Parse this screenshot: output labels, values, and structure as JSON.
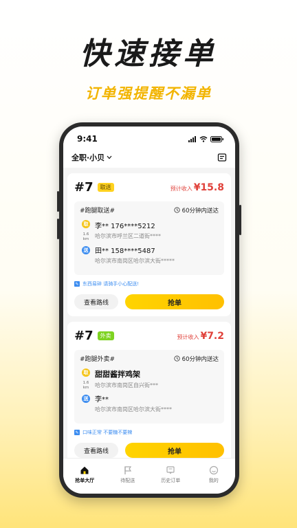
{
  "promo": {
    "headline": "快速接单",
    "subline": "订单强提醒不漏单"
  },
  "status_bar": {
    "time": "9:41"
  },
  "app_bar": {
    "user_label": "全职·小贝"
  },
  "orders": [
    {
      "number": "#7",
      "type_tag": "取送",
      "income_label": "预计收入",
      "income_value": "¥15.8",
      "category": "#跑腿取送#",
      "eta": "60分钟内送达",
      "pickup_badge": "取",
      "pickup_title": "李** 176****5212",
      "pickup_address": "哈尔滨市呼兰区二道街****",
      "distance_value": "1.6",
      "distance_unit": "km",
      "dropoff_badge": "送",
      "dropoff_title": "田** 158****5487",
      "dropoff_address": "哈尔滨市南岗区哈尔滨大街*****",
      "note": "东西易碎 请骑手小心配送!",
      "route_button": "查看路线",
      "grab_button": "抢单"
    },
    {
      "number": "#7",
      "type_tag": "外卖",
      "income_label": "预计收入",
      "income_value": "¥7.2",
      "category": "#跑腿外卖#",
      "eta": "60分钟内送达",
      "pickup_badge": "取",
      "pickup_title": "甜甜酱拌鸡架",
      "pickup_address": "哈尔滨市南岗区自兴街***",
      "distance_value": "1.6",
      "distance_unit": "km",
      "dropoff_badge": "送",
      "dropoff_title": "李**",
      "dropoff_address": "哈尔滨市南岗区哈尔滨大街****",
      "note": "口味正常 不要糖不要辣",
      "route_button": "查看路线",
      "grab_button": "抢单"
    }
  ],
  "tabs": [
    {
      "label": "抢单大厅",
      "icon": "home-icon",
      "active": true
    },
    {
      "label": "待配送",
      "icon": "flag-icon",
      "active": false
    },
    {
      "label": "历史订单",
      "icon": "history-icon",
      "active": false
    },
    {
      "label": "我的",
      "icon": "smile-icon",
      "active": false
    }
  ],
  "colors": {
    "accent_yellow": "#ffd400",
    "promo_yellow": "#f2b400",
    "price_red": "#e0413a",
    "tag_green": "#7ed321",
    "link_blue": "#3b8cf0"
  }
}
